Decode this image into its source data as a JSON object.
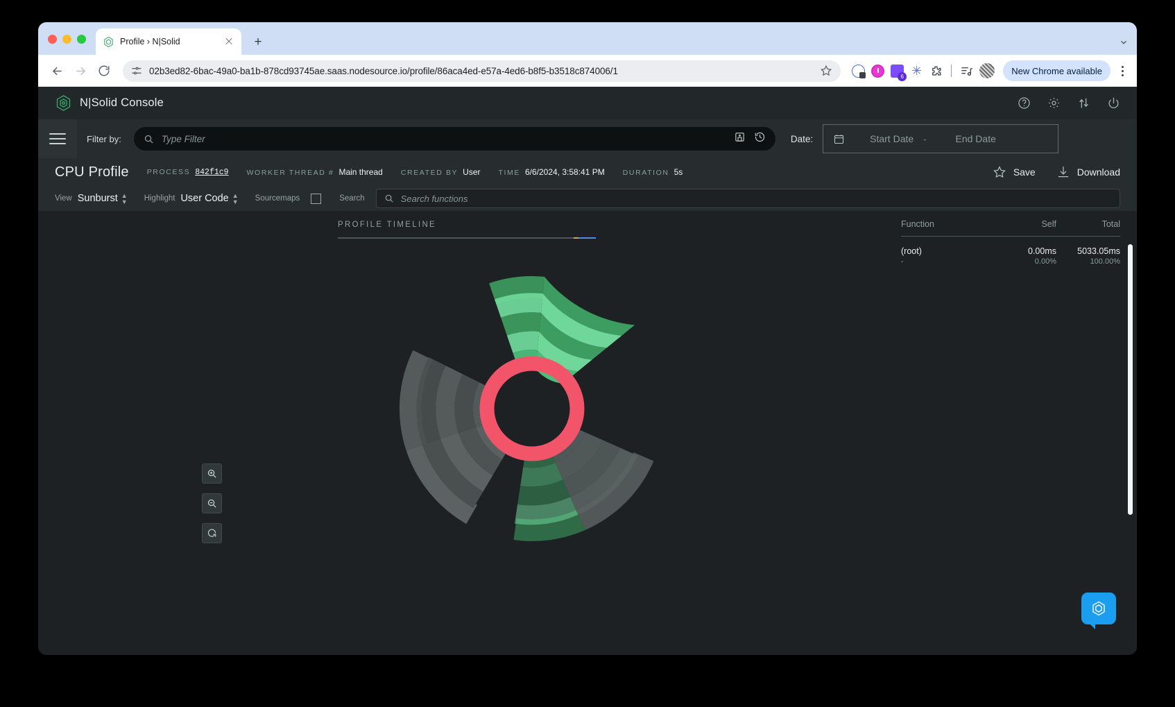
{
  "browser": {
    "tab": {
      "title": "Profile › N|Solid",
      "favicon": "nsolid-cube-icon",
      "close": "close-icon"
    },
    "new_tab_label": "+",
    "omnibox": {
      "url": "02b3ed82-6bac-49a0-ba1b-878cd93745ae.saas.nodesource.io/profile/86aca4ed-e57a-4ed6-b8f5-b3518c874006/1",
      "site_settings_icon": "site-settings-icon",
      "bookmark_icon": "star-icon"
    },
    "nav": {
      "back": "back-arrow-icon",
      "forward": "forward-arrow-icon",
      "reload": "reload-icon"
    },
    "extensions": [
      "speedtest-icon",
      "power-toggle-icon",
      "layers-badge-icon",
      "asterisk-icon",
      "puzzle-icon",
      "media-list-icon"
    ],
    "extension_badge": "6",
    "profile_avatar": "avatar",
    "new_chrome_label": "New Chrome available",
    "menu_icon": "kebab-menu-icon"
  },
  "app": {
    "brand": {
      "name": "N|Solid Console",
      "logo": "nsolid-cube-icon"
    },
    "header_icons": [
      "help-icon",
      "settings-gear-icon",
      "compare-icon",
      "power-icon"
    ],
    "filterbar": {
      "menu_icon": "hamburger-menu-icon",
      "label": "Filter by:",
      "placeholder": "Type Filter",
      "search_icon": "search-icon",
      "save_filter_icon": "save-filter-icon",
      "history_icon": "history-icon",
      "date_label": "Date:",
      "calendar_icon": "calendar-icon",
      "start_placeholder": "Start Date",
      "separator": "-",
      "end_placeholder": "End Date"
    },
    "profile": {
      "title": "CPU Profile",
      "meta": [
        {
          "key": "PROCESS",
          "value": "842f1c9",
          "mono": true
        },
        {
          "key": "WORKER THREAD #",
          "value": "Main thread",
          "mono": false
        },
        {
          "key": "CREATED BY",
          "value": "User",
          "mono": false
        },
        {
          "key": "TIME",
          "value": "6/6/2024, 3:58:41 PM",
          "mono": false
        },
        {
          "key": "DURATION",
          "value": "5s",
          "mono": false
        }
      ],
      "save_label": "Save",
      "save_icon": "star-icon",
      "download_label": "Download",
      "download_icon": "download-icon"
    },
    "view_bar": {
      "view_label": "View",
      "view_value": "Sunburst",
      "highlight_label": "Highlight",
      "highlight_value": "User Code",
      "sourcemaps_label": "Sourcemaps",
      "sourcemaps_checked": false,
      "search_label": "Search",
      "search_placeholder": "Search functions",
      "search_icon": "search-icon",
      "spinner_icon": "chevron-updown-icon"
    },
    "timeline": {
      "title": "PROFILE TIMELINE"
    },
    "zoom_controls": [
      {
        "name": "zoom-in-button",
        "icon": "magnifier-plus-icon"
      },
      {
        "name": "zoom-out-button",
        "icon": "magnifier-minus-icon"
      },
      {
        "name": "reset-zoom-button",
        "icon": "reset-icon"
      }
    ],
    "panel": {
      "columns": {
        "function": "Function",
        "self": "Self",
        "total": "Total"
      },
      "rows": [
        {
          "function": "(root)",
          "function_sub": "-",
          "self": "0.00ms",
          "self_pct": "0.00%",
          "total": "5033.05ms",
          "total_pct": "100.00%"
        }
      ]
    },
    "chat_icon": "nsolid-cube-icon",
    "colors": {
      "accent_green": "#4fc77f",
      "highlight_red": "#f2546a",
      "background": "#1d2123",
      "panel_bg": "#222729"
    }
  },
  "chart_data": {
    "type": "sunburst",
    "title": "CPU Profile Sunburst",
    "center_label": "(root)",
    "total_ms": 5033.05,
    "rings": [
      {
        "ring": 1,
        "inner_r": 55,
        "outer_r": 72,
        "segments": [
          {
            "start": 0,
            "end": 360,
            "color": "#f2546a",
            "label": "(root)"
          }
        ]
      },
      {
        "ring": 2,
        "inner_r": 76,
        "outer_r": 100,
        "segments": [
          {
            "start": 265,
            "end": 360,
            "color": "#4cbf7a"
          },
          {
            "start": 0,
            "end": 30,
            "color": "#4cbf7a"
          },
          {
            "start": 30,
            "end": 150,
            "color": "#5a5f5f"
          },
          {
            "start": 150,
            "end": 265,
            "color": "#3f9e5e"
          }
        ]
      },
      {
        "ring": 3,
        "inner_r": 104,
        "outer_r": 128,
        "segments": [
          {
            "start": 268,
            "end": 360,
            "color": "#6fd79a"
          },
          {
            "start": 0,
            "end": 28,
            "color": "#6fd79a"
          },
          {
            "start": 30,
            "end": 150,
            "color": "#4d5252"
          },
          {
            "start": 152,
            "end": 265,
            "color": "#58c184"
          }
        ]
      },
      {
        "ring": 4,
        "inner_r": 132,
        "outer_r": 156,
        "segments": [
          {
            "start": 270,
            "end": 360,
            "color": "#3d9c5f"
          },
          {
            "start": 0,
            "end": 26,
            "color": "#3d9c5f"
          },
          {
            "start": 32,
            "end": 150,
            "color": "#5c6262"
          },
          {
            "start": 155,
            "end": 264,
            "color": "#3d9c5f"
          }
        ]
      },
      {
        "ring": 5,
        "inner_r": 160,
        "outer_r": 184,
        "segments": [
          {
            "start": 272,
            "end": 360,
            "color": "#6fd79a"
          },
          {
            "start": 0,
            "end": 24,
            "color": "#6fd79a"
          },
          {
            "start": 36,
            "end": 148,
            "color": "#4a5050"
          },
          {
            "start": 158,
            "end": 262,
            "color": "#6fd79a"
          }
        ]
      },
      {
        "ring": 6,
        "inner_r": 188,
        "outer_r": 212,
        "segments": [
          {
            "start": 276,
            "end": 360,
            "color": "#3d9c5f"
          },
          {
            "start": 0,
            "end": 20,
            "color": "#3d9c5f"
          },
          {
            "start": 44,
            "end": 146,
            "color": "#5c6262"
          },
          {
            "start": 164,
            "end": 258,
            "color": "#3d9c5f"
          }
        ]
      }
    ],
    "legend": [],
    "notes": "Three-armed pinwheel sunburst; green arcs are user code, grey arcs non-highlighted frames, red innermost ring is root."
  }
}
